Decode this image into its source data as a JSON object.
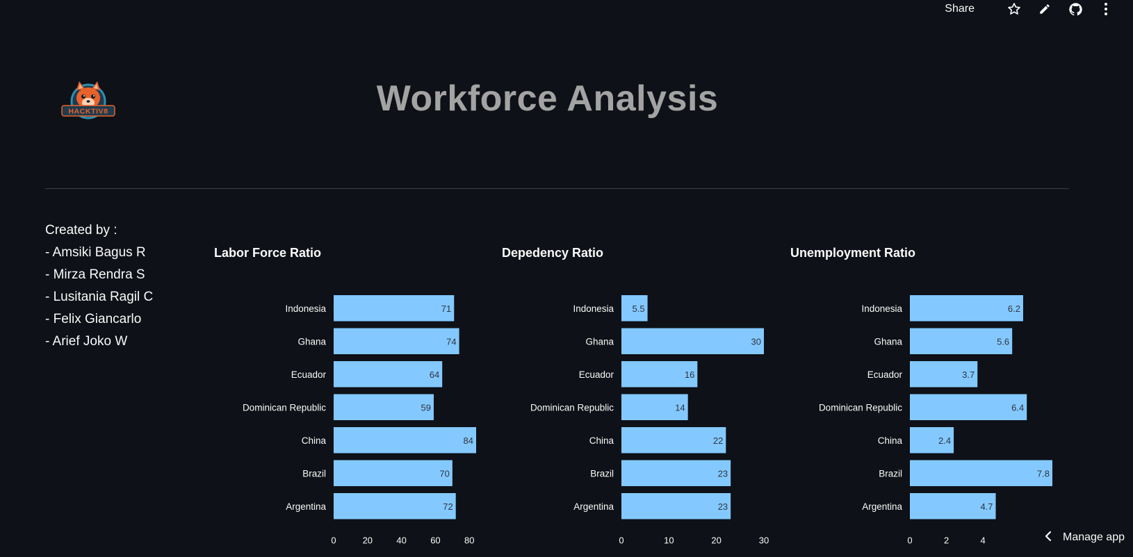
{
  "toolbar": {
    "share_label": "Share",
    "icons": [
      "star-icon",
      "pencil-icon",
      "github-icon",
      "more-vertical-icon"
    ]
  },
  "logo": {
    "text": "HACKTIV8",
    "colors": {
      "fur": "#e8622c",
      "ring": "#1f6f8b",
      "banner": "#1f3b4d"
    }
  },
  "header": {
    "title": "Workforce Analysis"
  },
  "credits": {
    "heading": "Created by :",
    "names": [
      "- Amsiki Bagus R",
      "- Mirza Rendra S",
      "- Lusitania Ragil C",
      "- Felix Giancarlo",
      "- Arief Joko W"
    ]
  },
  "colors": {
    "background": "#0e1117",
    "bar": "#83c9ff",
    "bar_label": "#31333f",
    "text": "#fafafa",
    "title_gray": "#a3a3a3",
    "divider": "#3d4048"
  },
  "chart_data": [
    {
      "type": "bar",
      "orientation": "horizontal",
      "title": "Labor Force Ratio",
      "categories": [
        "Indonesia",
        "Ghana",
        "Ecuador",
        "Dominican Republic",
        "China",
        "Brazil",
        "Argentina"
      ],
      "values": [
        71,
        74,
        64,
        59,
        84,
        70,
        72
      ],
      "value_labels": [
        "71",
        "74",
        "64",
        "59",
        "84",
        "70",
        "72"
      ],
      "xlim": [
        0,
        84
      ],
      "xticks": [
        0,
        20,
        40,
        60,
        80
      ],
      "xtick_labels": [
        "0",
        "20",
        "40",
        "60",
        "80"
      ],
      "xlabel": "",
      "ylabel": "",
      "grid": false
    },
    {
      "type": "bar",
      "orientation": "horizontal",
      "title": "Depedency Ratio",
      "categories": [
        "Indonesia",
        "Ghana",
        "Ecuador",
        "Dominican Republic",
        "China",
        "Brazil",
        "Argentina"
      ],
      "values": [
        5.5,
        30,
        16,
        14,
        22,
        23,
        23
      ],
      "value_labels": [
        "5.5",
        "30",
        "16",
        "14",
        "22",
        "23",
        "23"
      ],
      "xlim": [
        0,
        30
      ],
      "xticks": [
        0,
        10,
        20,
        30
      ],
      "xtick_labels": [
        "0",
        "10",
        "20",
        "30"
      ],
      "xlabel": "",
      "ylabel": "",
      "grid": false
    },
    {
      "type": "bar",
      "orientation": "horizontal",
      "title": "Unemployment Ratio",
      "categories": [
        "Indonesia",
        "Ghana",
        "Ecuador",
        "Dominican Republic",
        "China",
        "Brazil",
        "Argentina"
      ],
      "values": [
        6.2,
        5.6,
        3.7,
        6.4,
        2.4,
        7.8,
        4.7
      ],
      "value_labels": [
        "6.2",
        "5.6",
        "3.7",
        "6.4",
        "2.4",
        "7.8",
        "4.7"
      ],
      "xlim": [
        0,
        7.8
      ],
      "xticks": [
        0,
        2,
        4
      ],
      "xtick_labels": [
        "0",
        "2",
        "4"
      ],
      "xlabel": "",
      "ylabel": "",
      "grid": false
    }
  ],
  "manage_app": {
    "label": "Manage app"
  }
}
